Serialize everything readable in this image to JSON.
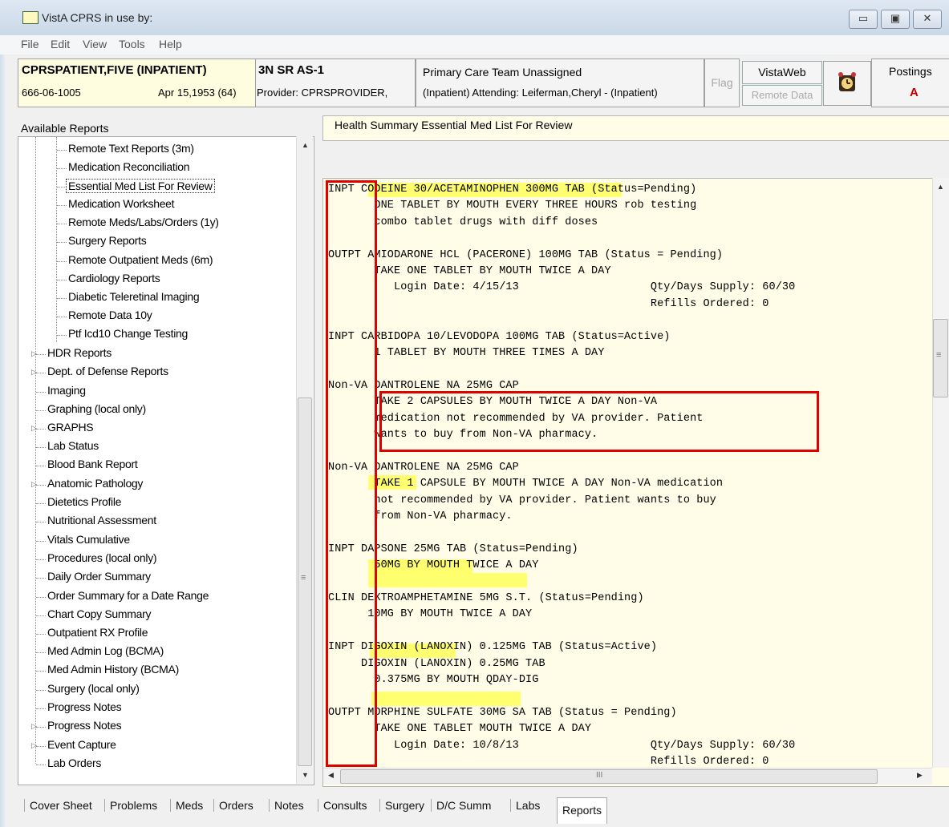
{
  "window": {
    "title": "VistA CPRS in use by:",
    "min": "▭",
    "max": "▣",
    "close": "✕"
  },
  "menu": [
    {
      "label": "File"
    },
    {
      "label": "Edit"
    },
    {
      "label": "View"
    },
    {
      "label": "Tools"
    },
    {
      "label": "Help"
    }
  ],
  "patient": {
    "name": "CPRSPATIENT,FIVE (INPATIENT)",
    "ssn": "666-06-1005",
    "dob": "Apr 15,1953 (64)",
    "location": "3N SR AS-1",
    "provider": "Provider: CPRSPROVIDER,",
    "team_line1": "Primary Care Team Unassigned",
    "team_line2": "(Inpatient) Attending:  Leiferman,Cheryl - (Inpatient)",
    "flag": "Flag",
    "vistaweb": "VistaWeb",
    "remote_data": "Remote Data",
    "postings_label": "Postings",
    "postings_code": "A"
  },
  "left": {
    "title": "Available Reports",
    "items": [
      "Remote Text Reports (3m)",
      "Medication Reconciliation",
      "Essential Med List For Review",
      "Medication Worksheet",
      "Remote Meds/Labs/Orders (1y)",
      "Surgery Reports",
      "Remote Outpatient Meds (6m)",
      "Cardiology Reports",
      "Diabetic Teleretinal Imaging",
      "Remote Data 10y",
      "Ptf Icd10 Change Testing",
      "HDR Reports",
      "Dept. of Defense Reports",
      "Imaging",
      "Graphing (local only)",
      "GRAPHS",
      "Lab Status",
      "Blood Bank Report",
      "Anatomic Pathology",
      "Dietetics Profile",
      "Nutritional Assessment",
      "Vitals Cumulative",
      "Procedures (local only)",
      "Daily Order Summary",
      "Order Summary for a Date Range",
      "Chart Copy Summary",
      "Outpatient RX Profile",
      "Med Admin Log (BCMA)",
      "Med Admin History (BCMA)",
      "Surgery (local only)",
      "Progress Notes",
      "Progress Notes",
      "Event Capture",
      "Lab Orders"
    ]
  },
  "report": {
    "title": "Health Summary Essential Med List For Review",
    "lines": [
      "INPT CODEINE 30/ACETAMINOPHEN 300MG TAB (Status=Pending)",
      "       ONE TABLET BY MOUTH EVERY THREE HOURS rob testing",
      "       combo tablet drugs with diff doses",
      "",
      "OUTPT AMIODARONE HCL (PACERONE) 100MG TAB (Status = Pending)",
      "       TAKE ONE TABLET BY MOUTH TWICE A DAY",
      "          Login Date: 4/15/13                    Qty/Days Supply: 60/30",
      "                                                 Refills Ordered: 0",
      "",
      "INPT CARBIDOPA 10/LEVODOPA 100MG TAB (Status=Active)",
      "       1 TABLET BY MOUTH THREE TIMES A DAY",
      "",
      "Non-VA DANTROLENE NA 25MG CAP",
      "       TAKE 2 CAPSULES BY MOUTH TWICE A DAY Non-VA",
      "       medication not recommended by VA provider. Patient",
      "       wants to buy from Non-VA pharmacy.",
      "",
      "Non-VA DANTROLENE NA 25MG CAP",
      "       TAKE 1 CAPSULE BY MOUTH TWICE A DAY Non-VA medication",
      "       not recommended by VA provider. Patient wants to buy",
      "       from Non-VA pharmacy.",
      "",
      "INPT DAPSONE 25MG TAB (Status=Pending)",
      "       50MG BY MOUTH TWICE A DAY",
      "",
      "CLIN DEXTROAMPHETAMINE 5MG S.T. (Status=Pending)",
      "      10MG BY MOUTH TWICE A DAY",
      "",
      "INPT DIGOXIN (LANOXIN) 0.125MG TAB (Status=Active)",
      "     DIGOXIN (LANOXIN) 0.25MG TAB",
      "       0.375MG BY MOUTH QDAY-DIG",
      "",
      "OUTPT MORPHINE SULFATE 30MG SA TAB (Status = Pending)",
      "       TAKE ONE TABLET MOUTH TWICE A DAY",
      "          Login Date: 10/8/13                    Qty/Days Supply: 60/30",
      "                                                 Refills Ordered: 0"
    ]
  },
  "tabs": [
    "Cover Sheet",
    "Problems",
    "Meds",
    "Orders",
    "Notes",
    "Consults",
    "Surgery",
    "D/C Summ",
    "Labs",
    "Reports"
  ],
  "scroll": {
    "h_mark": "III",
    "v_mark": "≡"
  },
  "colors": {
    "highlight": "#ffff5a",
    "annotation_box": "#e00000",
    "report_bg": "#fffde8"
  }
}
